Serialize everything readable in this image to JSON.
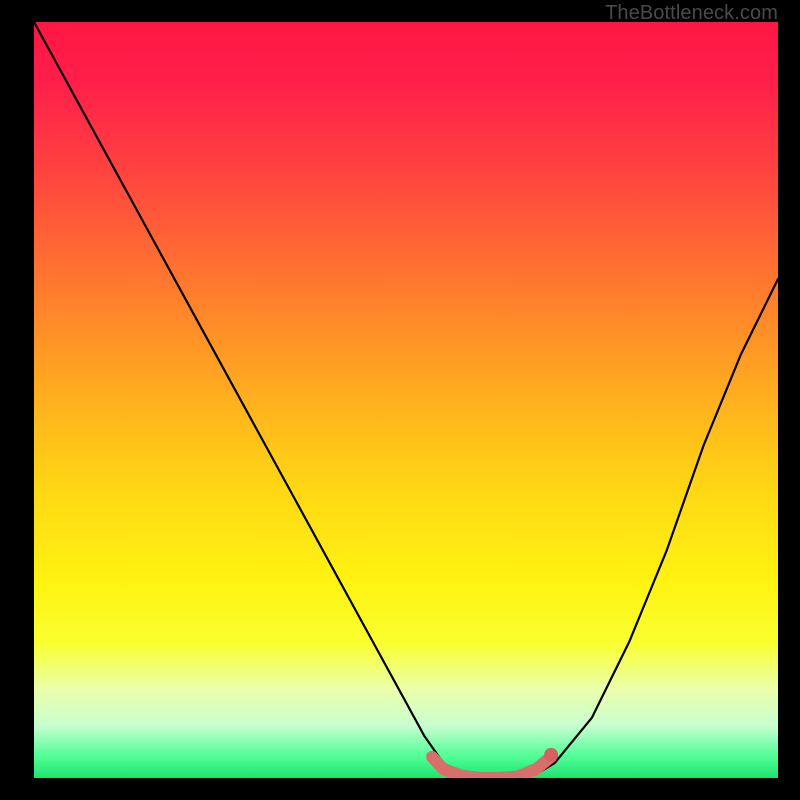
{
  "watermark": {
    "text": "TheBottleneck.com"
  },
  "chart_data": {
    "type": "line",
    "title": "",
    "xlabel": "",
    "ylabel": "",
    "series": [
      {
        "name": "bottleneck-curve",
        "x": [
          0.0,
          0.05,
          0.1,
          0.15,
          0.2,
          0.25,
          0.3,
          0.35,
          0.4,
          0.45,
          0.5,
          0.525,
          0.55,
          0.575,
          0.6,
          0.625,
          0.65,
          0.675,
          0.7,
          0.75,
          0.8,
          0.85,
          0.9,
          0.95,
          1.0
        ],
        "values": [
          1.0,
          0.91,
          0.82,
          0.73,
          0.64,
          0.55,
          0.46,
          0.37,
          0.28,
          0.19,
          0.1,
          0.055,
          0.02,
          0.005,
          0.0,
          0.0,
          0.0,
          0.005,
          0.02,
          0.08,
          0.18,
          0.3,
          0.44,
          0.56,
          0.66
        ]
      },
      {
        "name": "flat-zone-marker",
        "x": [
          0.535,
          0.55,
          0.575,
          0.6,
          0.625,
          0.65,
          0.675,
          0.695
        ],
        "values": [
          0.028,
          0.012,
          0.003,
          0.0,
          0.0,
          0.002,
          0.012,
          0.028
        ]
      }
    ],
    "xlim": [
      0,
      1
    ],
    "ylim": [
      0,
      1
    ],
    "annotations": [],
    "legend": []
  },
  "palette": {
    "gradient_stops": [
      {
        "offset": 0.0,
        "color": "#ff1744"
      },
      {
        "offset": 0.08,
        "color": "#ff1f4a"
      },
      {
        "offset": 0.2,
        "color": "#ff4440"
      },
      {
        "offset": 0.35,
        "color": "#ff7a2e"
      },
      {
        "offset": 0.5,
        "color": "#ffb01e"
      },
      {
        "offset": 0.62,
        "color": "#ffd814"
      },
      {
        "offset": 0.74,
        "color": "#fff312"
      },
      {
        "offset": 0.82,
        "color": "#f9ff2e"
      },
      {
        "offset": 0.88,
        "color": "#ecffa8"
      },
      {
        "offset": 0.93,
        "color": "#c8ffd0"
      },
      {
        "offset": 0.97,
        "color": "#52ff98"
      },
      {
        "offset": 1.0,
        "color": "#1de46e"
      }
    ],
    "curve_color": "#000000",
    "marker_color": "#d86f6a",
    "marker_dot_color": "#d86060"
  }
}
